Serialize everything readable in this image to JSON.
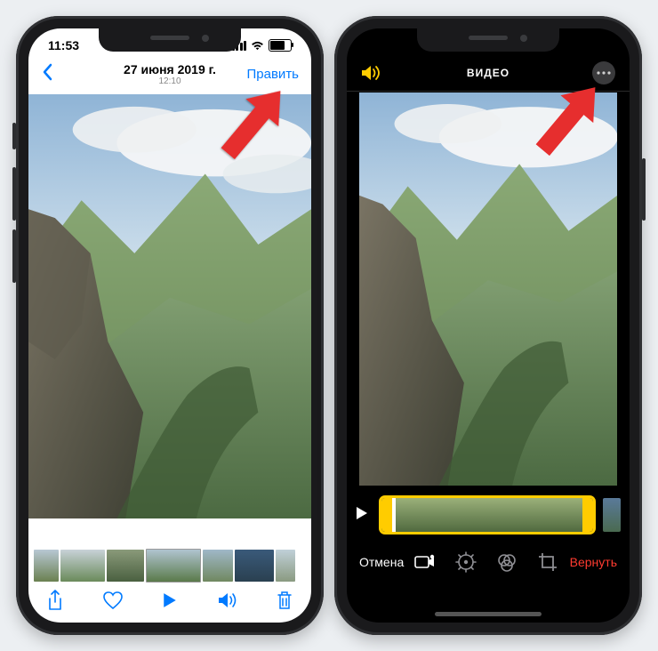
{
  "left": {
    "status": {
      "time": "11:53"
    },
    "nav": {
      "date": "27 июня 2019 г.",
      "time": "12:10",
      "edit_label": "Править"
    },
    "toolbar_icons": [
      "share",
      "favorite",
      "play",
      "volume",
      "delete"
    ]
  },
  "right": {
    "topbar": {
      "title": "ВИДЕО"
    },
    "bottom": {
      "cancel_label": "Отмена",
      "revert_label": "Вернуть"
    }
  }
}
